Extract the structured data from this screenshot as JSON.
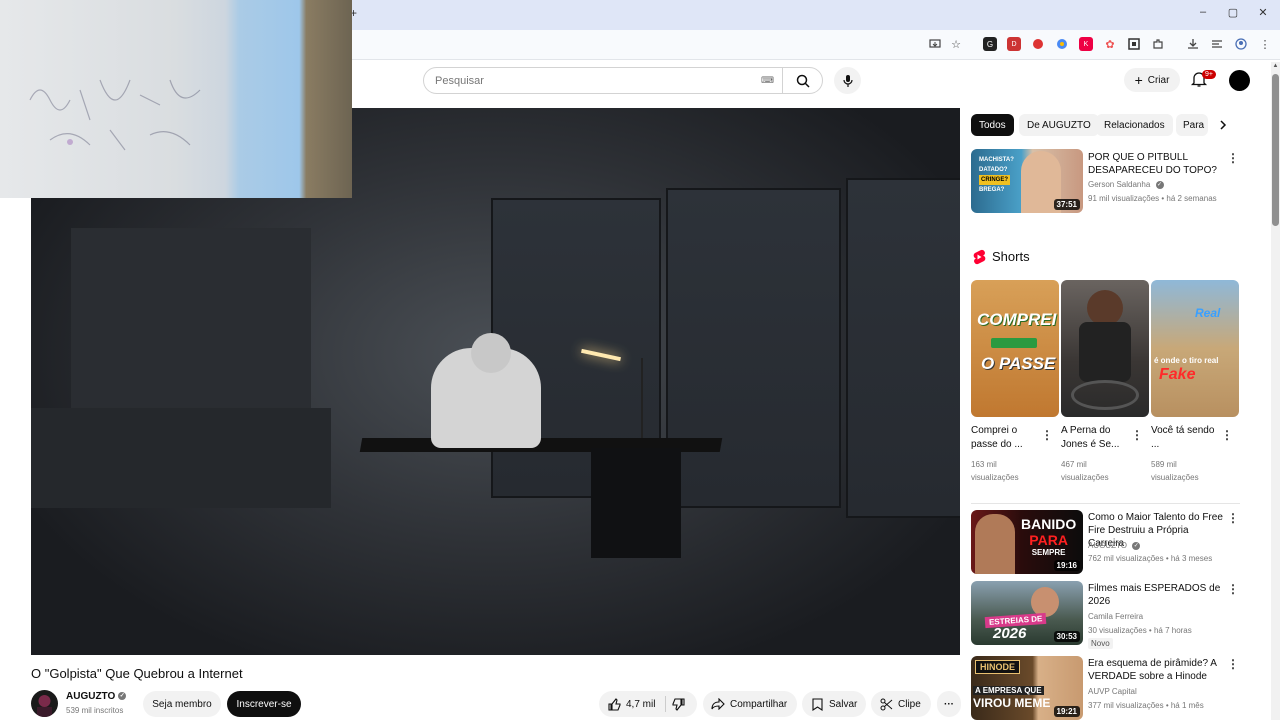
{
  "browser": {
    "window_controls": [
      "–",
      "▢",
      "✕"
    ],
    "new_tab": "+"
  },
  "header": {
    "search_placeholder": "Pesquisar",
    "create_label": "Criar",
    "notification_count": "9+"
  },
  "video": {
    "title": "O \"Golpista\" Que Quebrou a Internet",
    "channel": "AUGUZTO",
    "subscribers": "539 mil inscritos",
    "join_label": "Seja membro",
    "subscribe_label": "Inscrever-se",
    "likes": "4,7 mil",
    "share_label": "Compartilhar",
    "save_label": "Salvar",
    "clip_label": "Clipe"
  },
  "chips": [
    "Todos",
    "De AUGUZTO",
    "Relacionados",
    "Para"
  ],
  "related": [
    {
      "title": "POR QUE O PITBULL DESAPARECEU DO TOPO?",
      "channel": "Gerson Saldanha",
      "meta": "91 mil visualizações • há 2 semanas",
      "duration": "37:51",
      "thumb_text": [
        "MACHISTA?",
        "DATADO?",
        "CRINGE?",
        "BREGA?"
      ]
    },
    {
      "title": "Como o Maior Talento do Free Fire Destruiu a Própria Carreira",
      "channel": "AUGUZTO",
      "meta": "762 mil visualizações • há 3 meses",
      "duration": "19:16",
      "thumb_text": [
        "BANIDO",
        "PARA",
        "SEMPRE"
      ]
    },
    {
      "title": "Filmes mais ESPERADOS de 2026",
      "channel": "Camila Ferreira",
      "meta": "30 visualizações • há 7 horas",
      "badge": "Novo",
      "duration": "30:53",
      "thumb_text": [
        "ESTREIAS DE",
        "2026"
      ]
    },
    {
      "title": "Era esquema de pirâmide? A VERDADE sobre a Hinode",
      "channel": "AUVP Capital",
      "meta": "377 mil visualizações • há 1 mês",
      "duration": "19:21",
      "thumb_text": [
        "HINODE",
        "A EMPRESA QUE",
        "VIROU MEME"
      ]
    }
  ],
  "shorts": {
    "heading": "Shorts",
    "items": [
      {
        "title": "Comprei o passe do ...",
        "views": "163 mil visualizações",
        "thumb_text": [
          "COMPREI",
          "O PASSE"
        ]
      },
      {
        "title": "A Perna do Jones é Se...",
        "views": "467 mil visualizações",
        "thumb_text": []
      },
      {
        "title": "Você tá sendo ...",
        "views": "589 mil visualizações",
        "thumb_text": [
          "Real",
          "é onde o tiro real",
          "Fake"
        ]
      }
    ]
  },
  "colors": {
    "youtube_red": "#ff0033",
    "subscribe_bg": "#0f0f0f",
    "chip_active": "#0f0f0f"
  }
}
